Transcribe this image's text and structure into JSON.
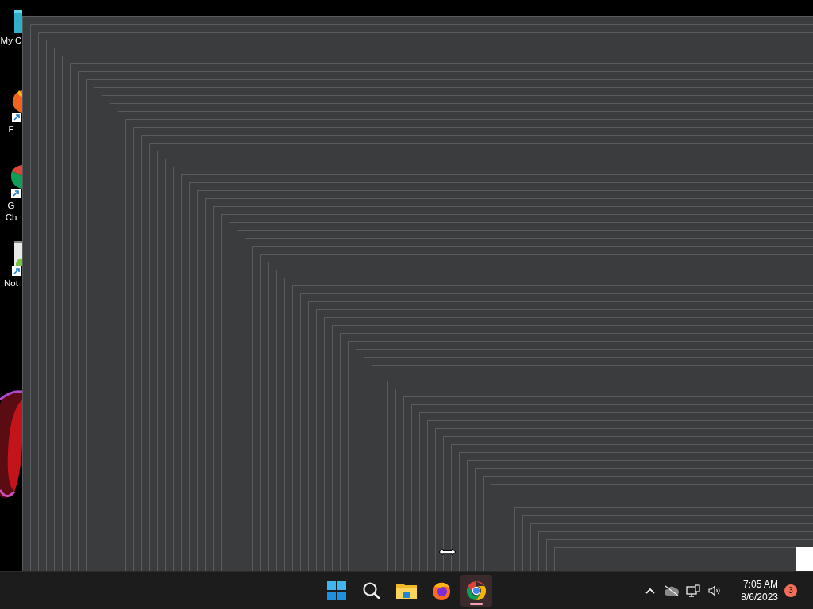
{
  "desktop_icons": [
    {
      "kind": "computer",
      "label": [
        "My C"
      ]
    },
    {
      "kind": "firefox",
      "label": [
        "F"
      ]
    },
    {
      "kind": "chrome",
      "label": [
        "G",
        "Ch"
      ]
    },
    {
      "kind": "notepad",
      "label": [
        "Not"
      ]
    }
  ],
  "taskbar": {
    "apps": [
      {
        "kind": "start",
        "selected": false
      },
      {
        "kind": "search",
        "selected": false
      },
      {
        "kind": "files",
        "selected": false
      },
      {
        "kind": "firefox",
        "selected": false
      },
      {
        "kind": "chrome",
        "selected": true
      }
    ],
    "tray": [
      {
        "kind": "chevron"
      },
      {
        "kind": "cloud-off"
      },
      {
        "kind": "network"
      },
      {
        "kind": "volume"
      }
    ],
    "clock": {
      "time": "7:05 AM",
      "date": "8/6/2023"
    },
    "notification_count": "3"
  }
}
